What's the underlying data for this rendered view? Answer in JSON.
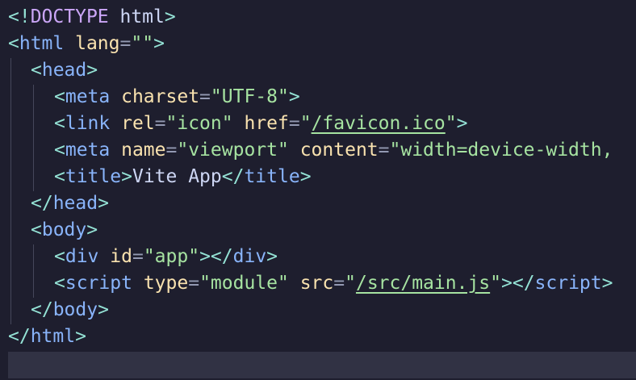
{
  "colors": {
    "background": "#1e1e2e",
    "tag": "#89b4fa",
    "punctuation": "#94e2d5",
    "attribute": "#f9e2af",
    "string": "#a6e3a1",
    "doctype": "#cba6f7",
    "text": "#cdd6f4",
    "current_line": "#313244"
  },
  "code": {
    "doctype": {
      "open": "<!",
      "keyword": "DOCTYPE",
      "name": " html",
      "close": ">"
    },
    "html_open": {
      "tag": "html",
      "attr": "lang",
      "value": "\"\""
    },
    "head_open": {
      "tag": "head"
    },
    "meta_charset": {
      "tag": "meta",
      "attr": "charset",
      "value": "\"UTF-8\""
    },
    "link_icon": {
      "tag": "link",
      "attr1": "rel",
      "value1": "\"icon\"",
      "attr2": "href",
      "value2_q": "\"",
      "value2_path": "/favicon.ico",
      "value2_q2": "\""
    },
    "meta_viewport": {
      "tag": "meta",
      "attr1": "name",
      "value1": "\"viewport\"",
      "attr2": "content",
      "value2": "\"width=device-width,"
    },
    "title": {
      "tag": "title",
      "text": "Vite App"
    },
    "head_close": {
      "tag": "head"
    },
    "body_open": {
      "tag": "body"
    },
    "div_app": {
      "tag": "div",
      "attr": "id",
      "value": "\"app\""
    },
    "script": {
      "tag": "script",
      "attr1": "type",
      "value1": "\"module\"",
      "attr2": "src",
      "value2_q": "\"",
      "value2_path": "/src/main.js",
      "value2_q2": "\""
    },
    "body_close": {
      "tag": "body"
    },
    "html_close": {
      "tag": "html"
    }
  }
}
